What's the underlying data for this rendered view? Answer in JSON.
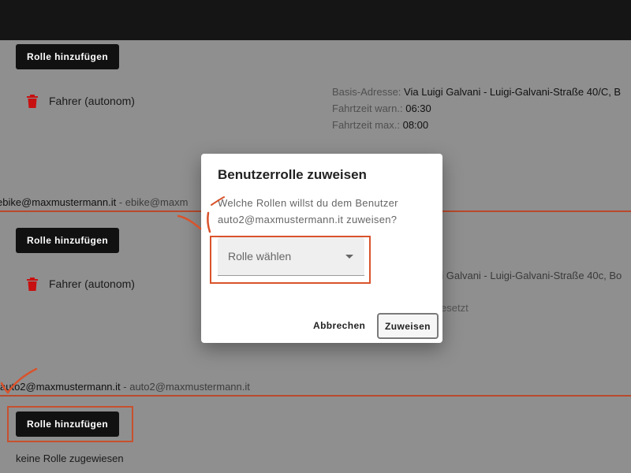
{
  "colors": {
    "topbar": "#151515",
    "page_bg": "#8f8f8f",
    "divider": "#b84a2c",
    "annotation": "#d9532c",
    "trash": "#c81010"
  },
  "users": [
    {
      "add_role_label": "Rolle hinzufügen",
      "roles": [
        {
          "name": "Fahrer (autonom)",
          "icon": "trash-icon"
        }
      ],
      "details": {
        "base_address_key": "Basis-Adresse:",
        "base_address_value": "Via Luigi Galvani - Luigi-Galvani-Straße 40/C, B",
        "drive_warn_key": "Fahrtzeit warn.:",
        "drive_warn_value": "06:30",
        "drive_max_key": "Fahrtzeit max.:",
        "drive_max_value": "08:00"
      }
    },
    {
      "email": "ebike@maxmustermann.it",
      "email_secondary": "ebike@maxm",
      "add_role_label": "Rolle hinzufügen",
      "roles": [
        {
          "name": "Fahrer (autonom)",
          "icon": "trash-icon"
        }
      ],
      "details": {
        "base_address_partial": "gi Galvani - Luigi-Galvani-Straße 40c, Bo",
        "status_partial": "esetzt"
      }
    },
    {
      "email": "auto2@maxmustermann.it",
      "email_secondary": "auto2@maxmustermann.it",
      "add_role_label": "Rolle hinzufügen",
      "no_role_text": "keine Rolle zugewiesen"
    }
  ],
  "dialog": {
    "title": "Benutzerrolle zuweisen",
    "message": "Welche Rollen willst du dem Benutzer auto2@maxmustermann.it zuweisen?",
    "select_placeholder": "Rolle wählen",
    "cancel_label": "Abbrechen",
    "confirm_label": "Zuweisen"
  },
  "separator": " - "
}
